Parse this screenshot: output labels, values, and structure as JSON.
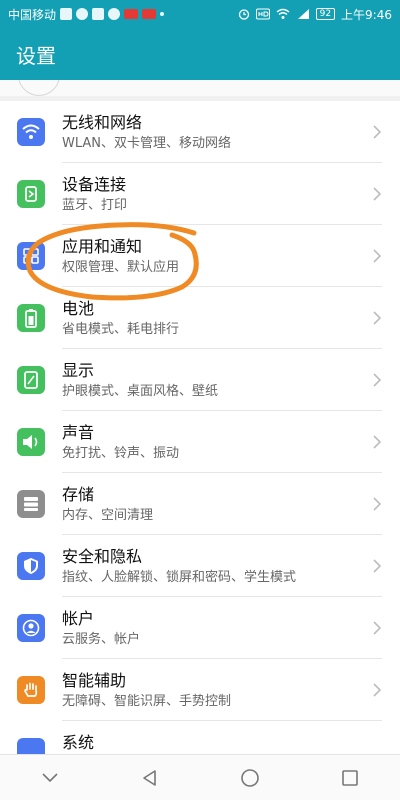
{
  "status_bar": {
    "carrier": "中国移动",
    "battery_level": "92",
    "time": "上午9:46"
  },
  "app_bar": {
    "title": "设置"
  },
  "items": [
    {
      "name": "network",
      "title": "无线和网络",
      "subtitle": "WLAN、双卡管理、移动网络",
      "icon": "wifi-icon",
      "color": "#4b78f0"
    },
    {
      "name": "device-connection",
      "title": "设备连接",
      "subtitle": "蓝牙、打印",
      "icon": "device-connection-icon",
      "color": "#44c05f"
    },
    {
      "name": "apps-notifications",
      "title": "应用和通知",
      "subtitle": "权限管理、默认应用",
      "icon": "apps-grid-icon",
      "color": "#4b78f0"
    },
    {
      "name": "battery",
      "title": "电池",
      "subtitle": "省电模式、耗电排行",
      "icon": "battery-icon",
      "color": "#44c05f"
    },
    {
      "name": "display",
      "title": "显示",
      "subtitle": "护眼模式、桌面风格、壁纸",
      "icon": "display-icon",
      "color": "#44c05f"
    },
    {
      "name": "sound",
      "title": "声音",
      "subtitle": "免打扰、铃声、振动",
      "icon": "speaker-icon",
      "color": "#44c05f"
    },
    {
      "name": "storage",
      "title": "存储",
      "subtitle": "内存、空间清理",
      "icon": "storage-icon",
      "color": "#8e8e8e"
    },
    {
      "name": "security-privacy",
      "title": "安全和隐私",
      "subtitle": "指纹、人脸解锁、锁屏和密码、学生模式",
      "icon": "shield-icon",
      "color": "#4b78f0"
    },
    {
      "name": "account",
      "title": "帐户",
      "subtitle": "云服务、帐户",
      "icon": "account-icon",
      "color": "#4b78f0"
    },
    {
      "name": "accessibility",
      "title": "智能辅助",
      "subtitle": "无障碍、智能识屏、手势控制",
      "icon": "hand-gesture-icon",
      "color": "#f08a24"
    },
    {
      "name": "system",
      "title": "系统",
      "subtitle": "",
      "icon": "system-icon",
      "color": "#4b78f0"
    }
  ],
  "colors": {
    "accent": "#13a0b4",
    "annotation": "#f08a24"
  }
}
